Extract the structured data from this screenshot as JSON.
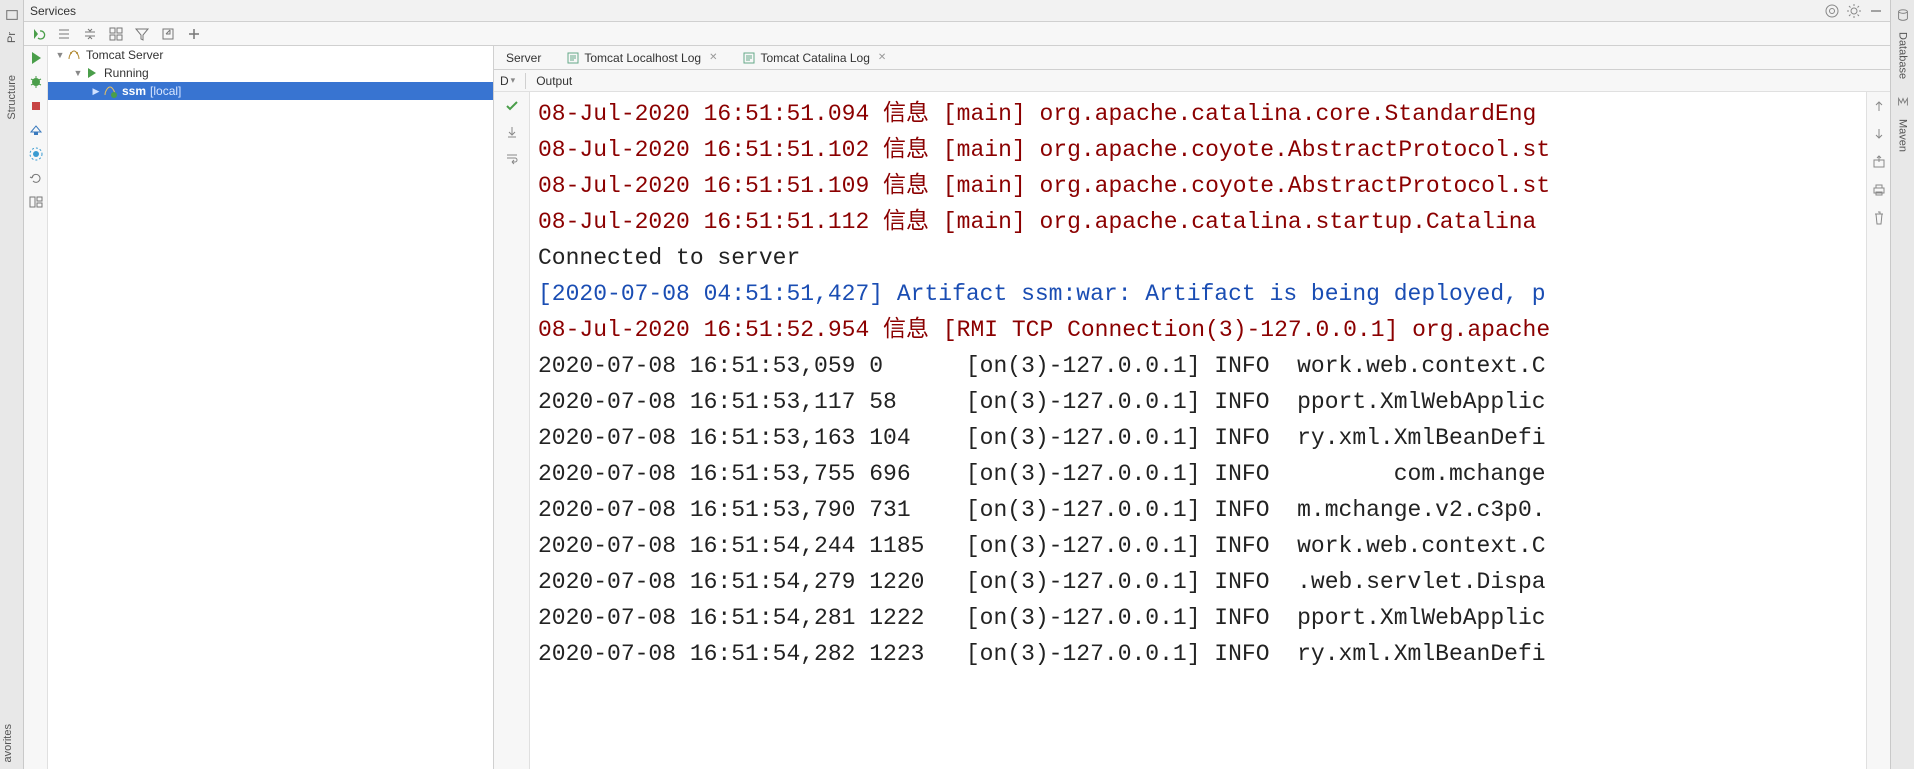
{
  "panel_title": "Services",
  "left_stripe": {
    "project": "Pr",
    "structure": "Structure"
  },
  "right_stripe": {
    "database": "Database",
    "maven": "Maven"
  },
  "favorites": "avorites",
  "toolbar": {
    "tooltips": [
      "rerun",
      "filter",
      "tree",
      "group",
      "sort",
      "expand",
      "add"
    ]
  },
  "tree": {
    "root": {
      "label": "Tomcat Server"
    },
    "running": {
      "label": "Running"
    },
    "node": {
      "label": "ssm",
      "extra": "[local]"
    }
  },
  "tabs": {
    "server": "Server",
    "localhost": "Tomcat Localhost Log",
    "catalina": "Tomcat Catalina Log"
  },
  "subrow": {
    "debug_label": "D",
    "output_label": "Output"
  },
  "console": {
    "lines": [
      {
        "cls": "l-info",
        "text": "08-Jul-2020 16:51:51.094 信息 [main] org.apache.catalina.core.StandardEng"
      },
      {
        "cls": "l-info",
        "text": "08-Jul-2020 16:51:51.102 信息 [main] org.apache.coyote.AbstractProtocol.st"
      },
      {
        "cls": "l-info",
        "text": "08-Jul-2020 16:51:51.109 信息 [main] org.apache.coyote.AbstractProtocol.st"
      },
      {
        "cls": "l-info",
        "text": "08-Jul-2020 16:51:51.112 信息 [main] org.apache.catalina.startup.Catalina"
      },
      {
        "cls": "l-plain",
        "text": "Connected to server"
      },
      {
        "cls": "l-art",
        "text": "[2020-07-08 04:51:51,427] Artifact ssm:war: Artifact is being deployed, p"
      },
      {
        "cls": "l-info",
        "text": "08-Jul-2020 16:51:52.954 信息 [RMI TCP Connection(3)-127.0.0.1] org.apache"
      },
      {
        "cls": "l-plain",
        "text": "2020-07-08 16:51:53,059 0      [on(3)-127.0.0.1] INFO  work.web.context.C"
      },
      {
        "cls": "l-plain",
        "text": "2020-07-08 16:51:53,117 58     [on(3)-127.0.0.1] INFO  pport.XmlWebApplic"
      },
      {
        "cls": "l-plain",
        "text": "2020-07-08 16:51:53,163 104    [on(3)-127.0.0.1] INFO  ry.xml.XmlBeanDefi"
      },
      {
        "cls": "l-plain",
        "text": "2020-07-08 16:51:53,755 696    [on(3)-127.0.0.1] INFO         com.mchange"
      },
      {
        "cls": "l-plain",
        "text": "2020-07-08 16:51:53,790 731    [on(3)-127.0.0.1] INFO  m.mchange.v2.c3p0."
      },
      {
        "cls": "l-plain",
        "text": "2020-07-08 16:51:54,244 1185   [on(3)-127.0.0.1] INFO  work.web.context.C"
      },
      {
        "cls": "l-plain",
        "text": "2020-07-08 16:51:54,279 1220   [on(3)-127.0.0.1] INFO  .web.servlet.Dispa"
      },
      {
        "cls": "l-plain",
        "text": "2020-07-08 16:51:54,281 1222   [on(3)-127.0.0.1] INFO  pport.XmlWebApplic"
      },
      {
        "cls": "l-plain",
        "text": "2020-07-08 16:51:54,282 1223   [on(3)-127.0.0.1] INFO  ry.xml.XmlBeanDefi"
      }
    ]
  }
}
